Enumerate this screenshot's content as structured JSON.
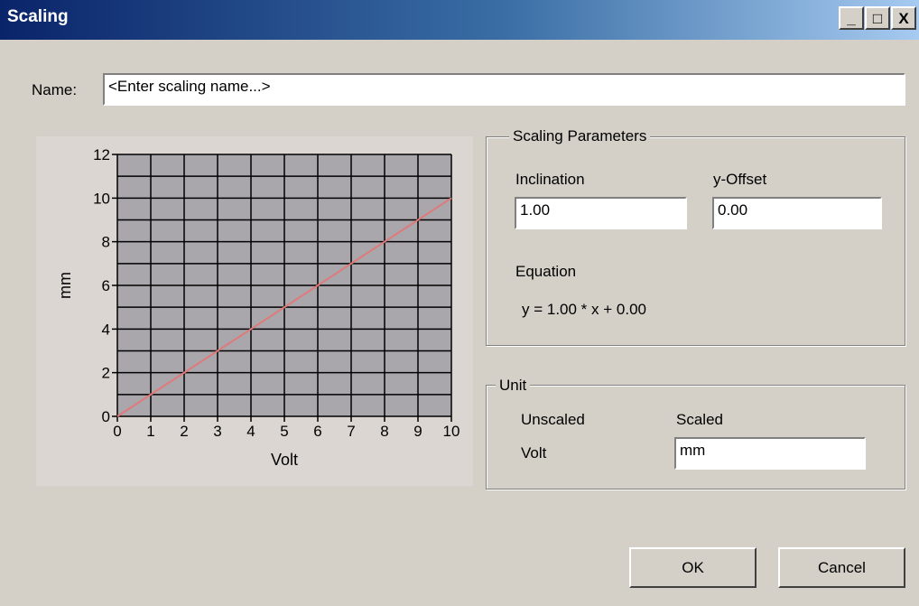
{
  "window": {
    "title": "Scaling",
    "minimize_label": "_",
    "maximize_label": "□",
    "close_label": "X"
  },
  "name_field": {
    "label": "Name:",
    "value": "<Enter scaling name...>"
  },
  "scaling_parameters": {
    "title": "Scaling Parameters",
    "inclination_label": "Inclination",
    "inclination_value": "1.00",
    "offset_label": "y-Offset",
    "offset_value": "0.00",
    "equation_label": "Equation",
    "equation_text": "y = 1.00 * x + 0.00"
  },
  "unit": {
    "title": "Unit",
    "unscaled_label": "Unscaled",
    "unscaled_value": "Volt",
    "scaled_label": "Scaled",
    "scaled_value": "mm"
  },
  "buttons": {
    "ok": "OK",
    "cancel": "Cancel"
  },
  "colors": {
    "plot_background": "#a9a6ac",
    "line": "#e07a7a",
    "grid": "#000000"
  },
  "chart_data": {
    "type": "line",
    "xlabel": "Volt",
    "ylabel": "mm",
    "xlim": [
      0,
      10
    ],
    "ylim": [
      0,
      12
    ],
    "x_ticks": [
      0,
      1,
      2,
      3,
      4,
      5,
      6,
      7,
      8,
      9,
      10
    ],
    "y_ticks": [
      0,
      2,
      4,
      6,
      8,
      10,
      12
    ],
    "grid": true,
    "series": [
      {
        "x": [
          0,
          10
        ],
        "y": [
          0,
          10
        ]
      }
    ]
  }
}
